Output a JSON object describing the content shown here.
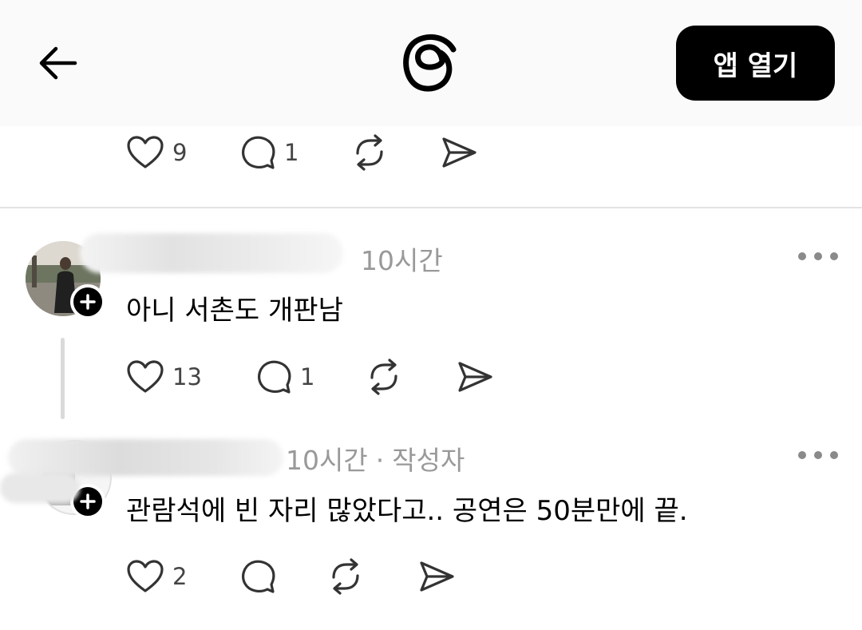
{
  "header": {
    "back_icon": "arrow-left-icon",
    "logo_icon": "threads-logo-icon",
    "open_app_label": "앱 열기"
  },
  "posts": [
    {
      "likes": "9",
      "replies": "1"
    },
    {
      "time": "10시간",
      "text": "아니 서촌도 개판남",
      "likes": "13",
      "replies": "1"
    },
    {
      "time": "10시간",
      "author_tag": "작성자",
      "separator": "·",
      "text": "관람석에 빈 자리 많았다고.. 공연은 50분만에 끝.",
      "likes": "2",
      "replies": ""
    }
  ],
  "icons": {
    "like": "heart-icon",
    "reply": "comment-icon",
    "repost": "repost-icon",
    "share": "send-icon",
    "more": "more-dots-icon",
    "follow": "plus-icon"
  },
  "colors": {
    "header_bg": "#fafafa",
    "button_bg": "#000000",
    "meta_text": "#999999",
    "divider": "#e4e4e4"
  }
}
